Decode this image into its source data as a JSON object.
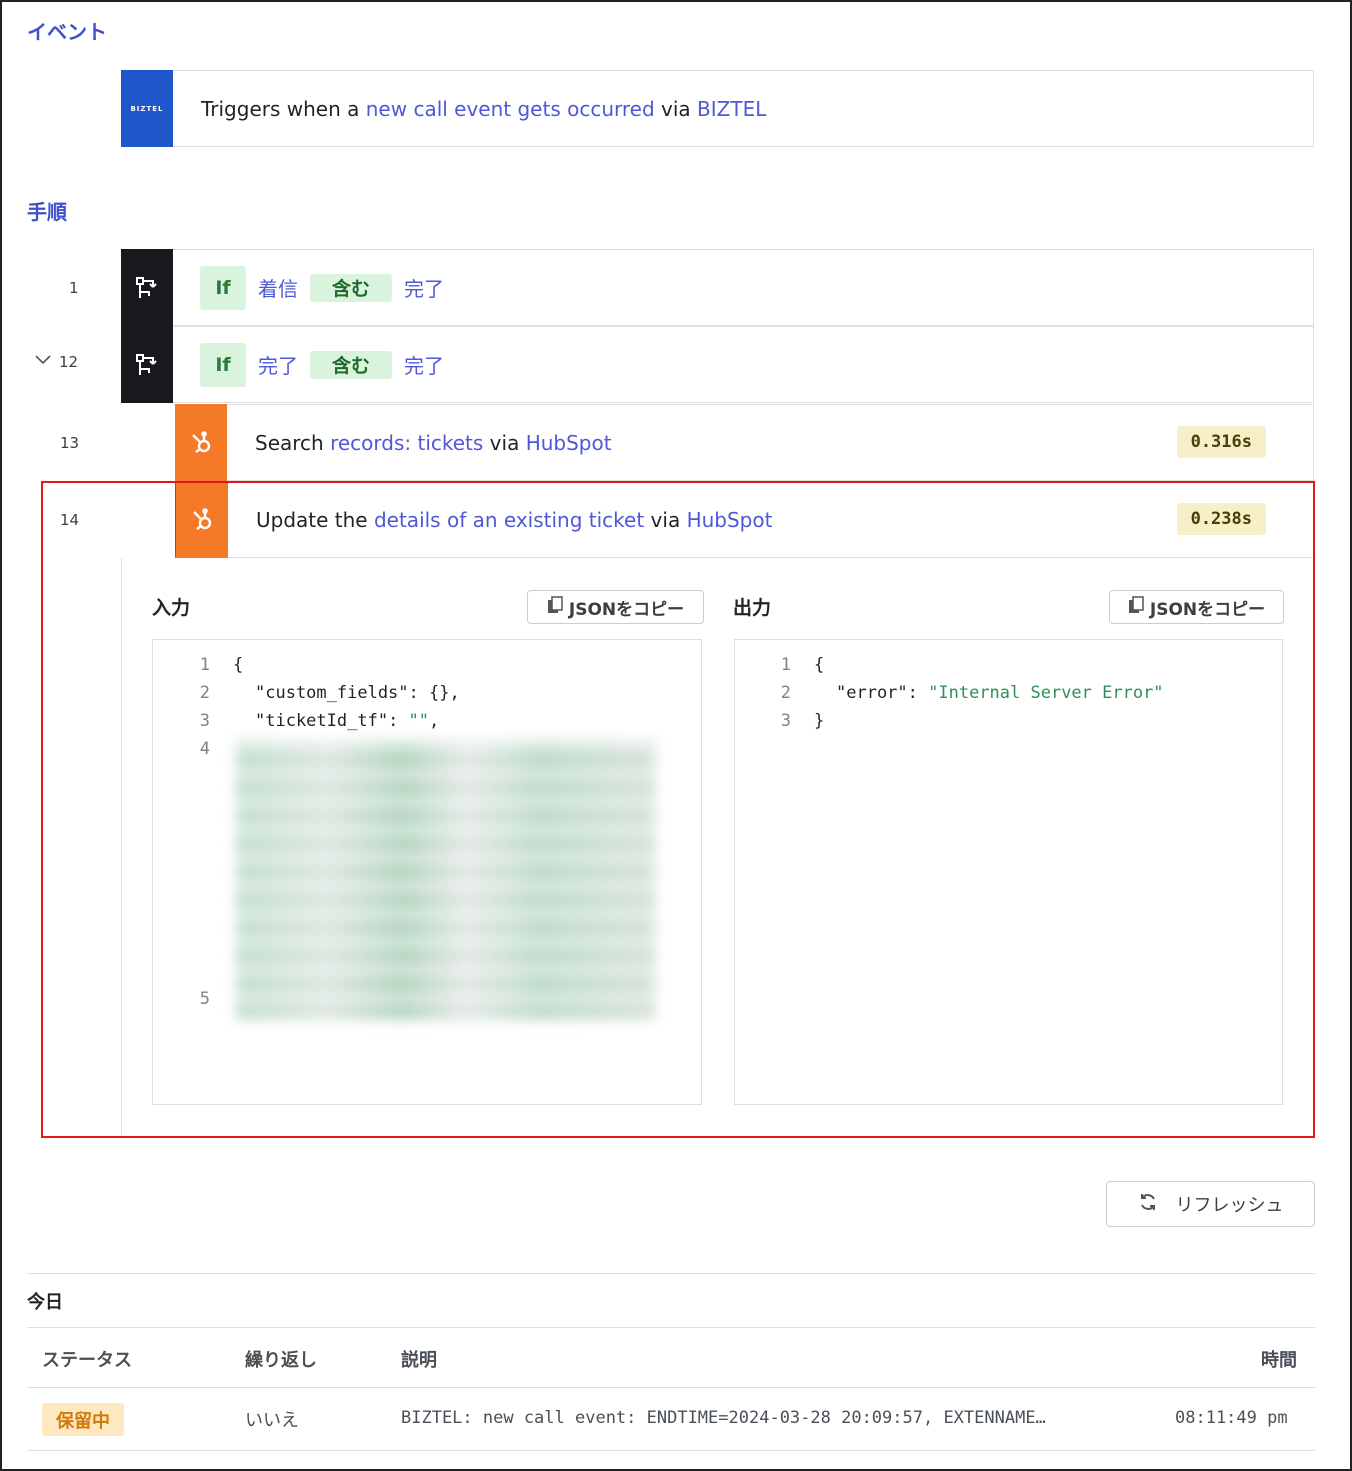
{
  "sections": {
    "event": "イベント",
    "steps": "手順"
  },
  "trigger": {
    "logo_text": "BIZTEL",
    "prefix": "Triggers when a ",
    "event": "new call event gets occurred",
    "mid": " via ",
    "app": "BIZTEL"
  },
  "steps": [
    {
      "num": "1",
      "cond_left": "着信",
      "cond_op": "含む",
      "cond_right": "完了",
      "if_label": "If"
    },
    {
      "num": "12",
      "cond_left": "完了",
      "cond_op": "含む",
      "cond_right": "完了",
      "if_label": "If"
    },
    {
      "num": "13",
      "prefix": "Search ",
      "object": "records: tickets",
      "mid": " via ",
      "app": "HubSpot",
      "time": "0.316s"
    },
    {
      "num": "14",
      "prefix": "Update the ",
      "object": "details of an existing ticket",
      "mid": " via ",
      "app": "HubSpot",
      "time": "0.238s"
    }
  ],
  "io": {
    "input_label": "入力",
    "output_label": "出力",
    "copy_label": "JSONをコピー",
    "input_lines": {
      "l1": "1",
      "l2": "2",
      "l3": "3",
      "l4": "4",
      "l5": "5",
      "c1": "{",
      "c2_key": "\"custom_fields\"",
      "c2_rest": ": {},",
      "c3_key": "\"ticketId_tf\"",
      "c3_mid": ": ",
      "c3_val": "\"\"",
      "c3_end": ","
    },
    "output_lines": {
      "l1": "1",
      "l2": "2",
      "l3": "3",
      "c1": "{",
      "c2_key": "\"error\"",
      "c2_mid": ": ",
      "c2_val": "\"Internal Server Error\"",
      "c3": "}"
    }
  },
  "refresh_label": "リフレッシュ",
  "history": {
    "title": "今日",
    "headers": {
      "status": "ステータス",
      "repeat": "繰り返し",
      "desc": "説明",
      "time": "時間"
    },
    "row": {
      "status": "保留中",
      "repeat": "いいえ",
      "desc": "BIZTEL: new call event: ENDTIME=2024-03-28 20:09:57, EXTENNAME…",
      "time": "08:11:49 pm"
    }
  },
  "colors": {
    "accent": "#4f58d6",
    "hubspot": "#f47a28",
    "biztel": "#1f56c9",
    "highlight": "#e01818",
    "pending_bg": "#fde8c2"
  }
}
